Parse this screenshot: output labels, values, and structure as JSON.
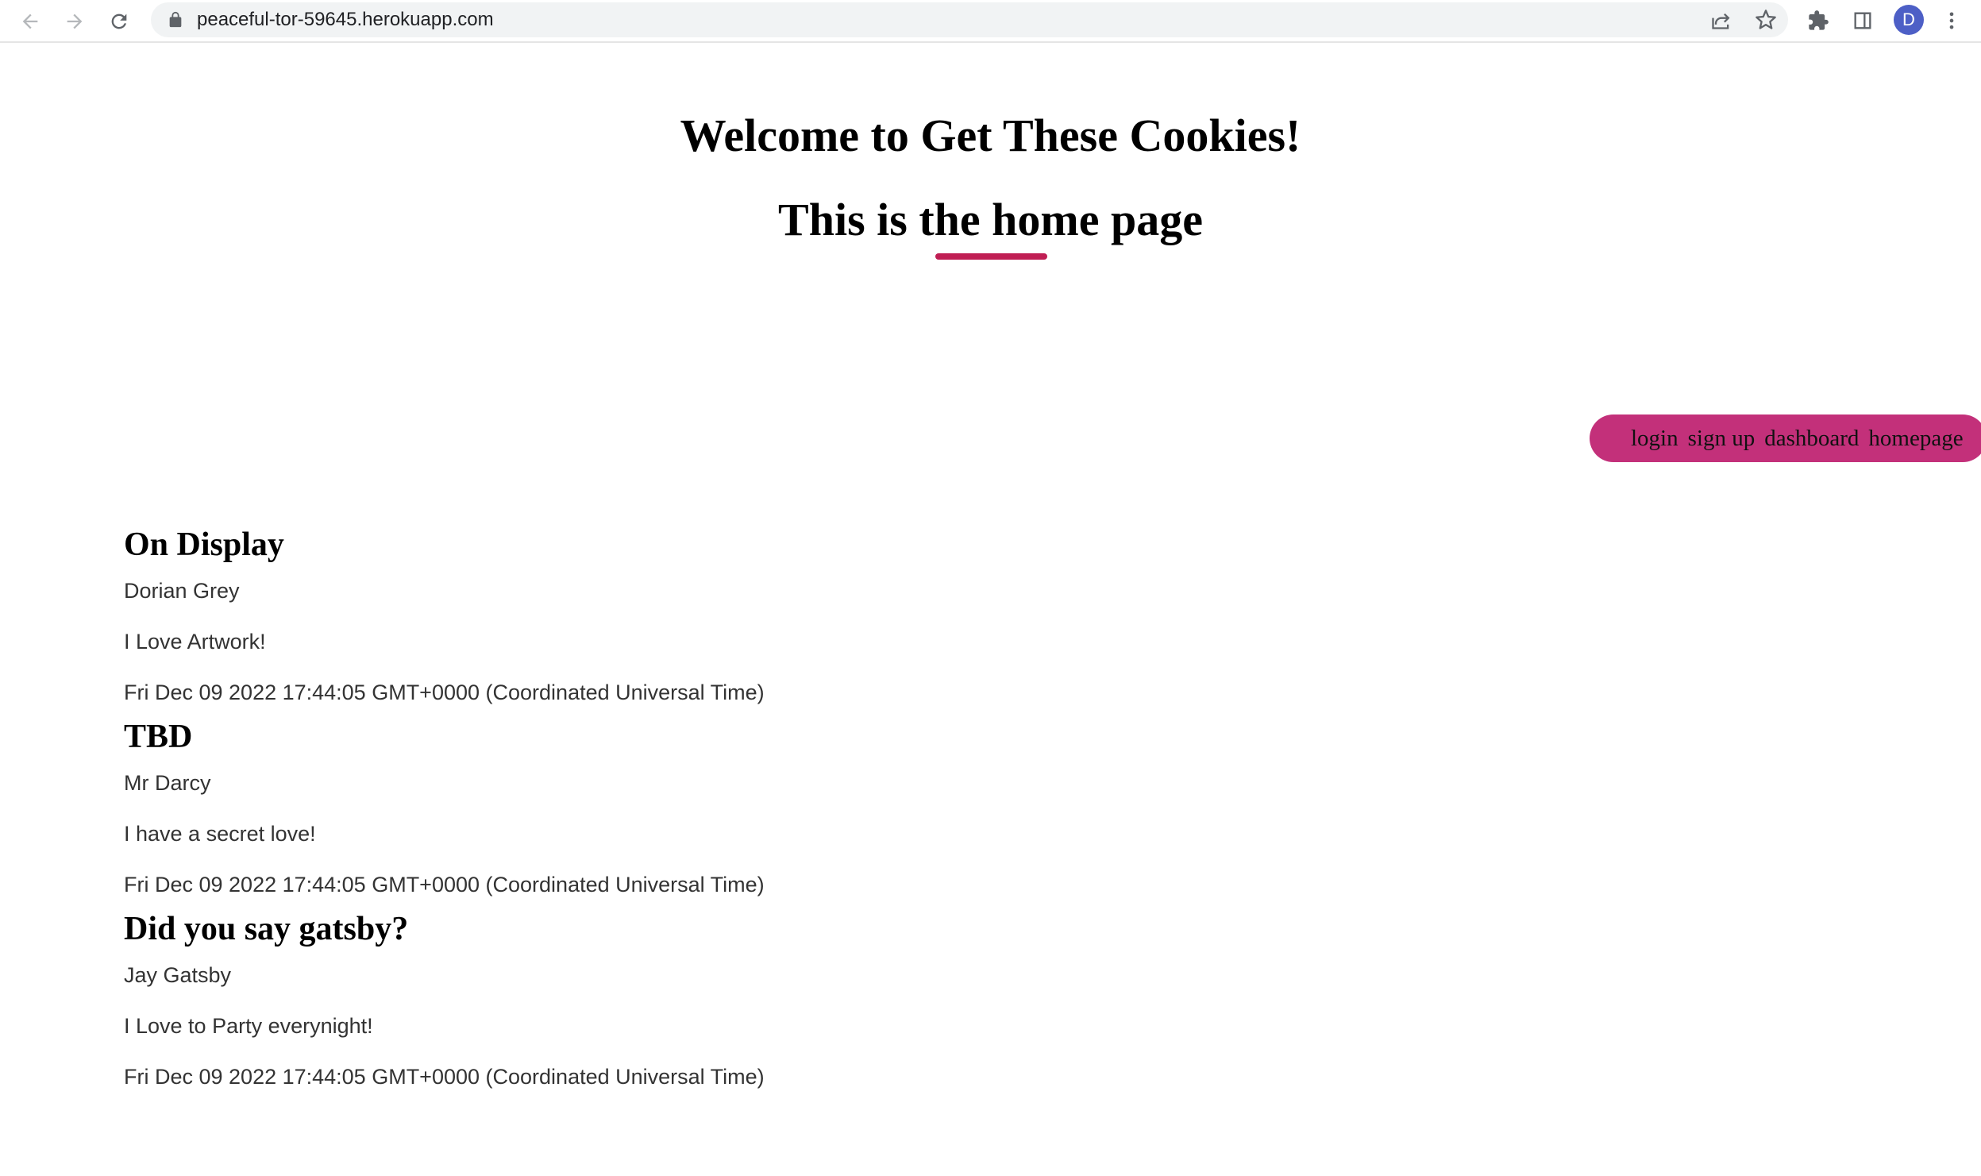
{
  "browser": {
    "url": "peaceful-tor-59645.herokuapp.com",
    "avatar_letter": "D",
    "icons": [
      "back-arrow-icon",
      "forward-arrow-icon",
      "reload-icon",
      "lock-icon",
      "share-icon",
      "star-icon",
      "extensions-icon",
      "side-panel-icon",
      "more-vert-icon"
    ]
  },
  "page": {
    "title": "Welcome to Get These Cookies!",
    "subtitle": "This is the home page",
    "accent_color": "#c01e54",
    "nav_color": "#c3307a"
  },
  "nav": {
    "links": [
      {
        "label": "login"
      },
      {
        "label": "sign up"
      },
      {
        "label": "dashboard"
      },
      {
        "label": "homepage"
      }
    ]
  },
  "posts": [
    {
      "title": "On Display",
      "author": "Dorian Grey",
      "body": "I Love Artwork!",
      "date": "Fri Dec 09 2022 17:44:05 GMT+0000 (Coordinated Universal Time)"
    },
    {
      "title": "TBD",
      "author": "Mr Darcy",
      "body": "I have a secret love!",
      "date": "Fri Dec 09 2022 17:44:05 GMT+0000 (Coordinated Universal Time)"
    },
    {
      "title": "Did you say gatsby?",
      "author": "Jay Gatsby",
      "body": "I Love to Party everynight!",
      "date": "Fri Dec 09 2022 17:44:05 GMT+0000 (Coordinated Universal Time)"
    }
  ]
}
